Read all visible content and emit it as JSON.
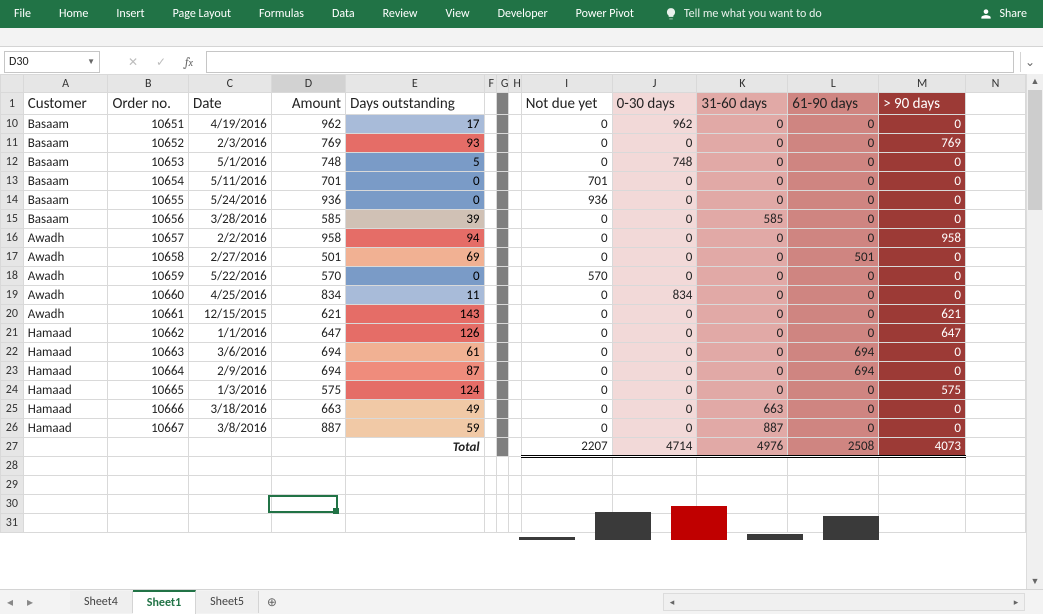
{
  "ribbon_tabs": [
    "File",
    "Home",
    "Insert",
    "Page Layout",
    "Formulas",
    "Data",
    "Review",
    "View",
    "Developer",
    "Power Pivot"
  ],
  "tell_me": "Tell me what you want to do",
  "share": "Share",
  "namebox": "D30",
  "columns": [
    "A",
    "B",
    "C",
    "D",
    "E",
    "F",
    "G",
    "H",
    "I",
    "J",
    "K",
    "L",
    "M",
    "N"
  ],
  "selected_col": "D",
  "header_row": {
    "A": "Customer",
    "B": "Order no.",
    "C": "Date",
    "D": "Amount",
    "E": "Days outstanding",
    "I": "Not due yet",
    "J": "0-30 days",
    "K": "31-60 days",
    "L": "61-90 days",
    "M": "> 90 days"
  },
  "rows": [
    {
      "r": 10,
      "A": "Basaam",
      "B": "10651",
      "C": "4/19/2016",
      "D": "962",
      "E": "17",
      "Eclass": "d1",
      "I": "0",
      "J": "962",
      "K": "0",
      "L": "0",
      "M": "0"
    },
    {
      "r": 11,
      "A": "Basaam",
      "B": "10652",
      "C": "2/3/2016",
      "D": "769",
      "E": "93",
      "Eclass": "d6",
      "I": "0",
      "J": "0",
      "K": "0",
      "L": "0",
      "M": "769"
    },
    {
      "r": 12,
      "A": "Basaam",
      "B": "10653",
      "C": "5/1/2016",
      "D": "748",
      "E": "5",
      "Eclass": "d0",
      "I": "0",
      "J": "748",
      "K": "0",
      "L": "0",
      "M": "0"
    },
    {
      "r": 13,
      "A": "Basaam",
      "B": "10654",
      "C": "5/11/2016",
      "D": "701",
      "E": "0",
      "Eclass": "d0",
      "I": "701",
      "J": "0",
      "K": "0",
      "L": "0",
      "M": "0"
    },
    {
      "r": 14,
      "A": "Basaam",
      "B": "10655",
      "C": "5/24/2016",
      "D": "936",
      "E": "0",
      "Eclass": "d0",
      "I": "936",
      "J": "0",
      "K": "0",
      "L": "0",
      "M": "0"
    },
    {
      "r": 15,
      "A": "Basaam",
      "B": "10656",
      "C": "3/28/2016",
      "D": "585",
      "E": "39",
      "Eclass": "d2",
      "I": "0",
      "J": "0",
      "K": "585",
      "L": "0",
      "M": "0"
    },
    {
      "r": 16,
      "A": "Awadh",
      "B": "10657",
      "C": "2/2/2016",
      "D": "958",
      "E": "94",
      "Eclass": "d6",
      "I": "0",
      "J": "0",
      "K": "0",
      "L": "0",
      "M": "958"
    },
    {
      "r": 17,
      "A": "Awadh",
      "B": "10658",
      "C": "2/27/2016",
      "D": "501",
      "E": "69",
      "Eclass": "d4",
      "I": "0",
      "J": "0",
      "K": "0",
      "L": "501",
      "M": "0"
    },
    {
      "r": 18,
      "A": "Awadh",
      "B": "10659",
      "C": "5/22/2016",
      "D": "570",
      "E": "0",
      "Eclass": "d0",
      "I": "570",
      "J": "0",
      "K": "0",
      "L": "0",
      "M": "0"
    },
    {
      "r": 19,
      "A": "Awadh",
      "B": "10660",
      "C": "4/25/2016",
      "D": "834",
      "E": "11",
      "Eclass": "d1",
      "I": "0",
      "J": "834",
      "K": "0",
      "L": "0",
      "M": "0"
    },
    {
      "r": 20,
      "A": "Awadh",
      "B": "10661",
      "C": "12/15/2015",
      "D": "621",
      "E": "143",
      "Eclass": "d6",
      "I": "0",
      "J": "0",
      "K": "0",
      "L": "0",
      "M": "621"
    },
    {
      "r": 21,
      "A": "Hamaad",
      "B": "10662",
      "C": "1/1/2016",
      "D": "647",
      "E": "126",
      "Eclass": "d6",
      "I": "0",
      "J": "0",
      "K": "0",
      "L": "0",
      "M": "647"
    },
    {
      "r": 22,
      "A": "Hamaad",
      "B": "10663",
      "C": "3/6/2016",
      "D": "694",
      "E": "61",
      "Eclass": "d4",
      "I": "0",
      "J": "0",
      "K": "0",
      "L": "694",
      "M": "0"
    },
    {
      "r": 23,
      "A": "Hamaad",
      "B": "10664",
      "C": "2/9/2016",
      "D": "694",
      "E": "87",
      "Eclass": "d5",
      "I": "0",
      "J": "0",
      "K": "0",
      "L": "694",
      "M": "0"
    },
    {
      "r": 24,
      "A": "Hamaad",
      "B": "10665",
      "C": "1/3/2016",
      "D": "575",
      "E": "124",
      "Eclass": "d6",
      "I": "0",
      "J": "0",
      "K": "0",
      "L": "0",
      "M": "575"
    },
    {
      "r": 25,
      "A": "Hamaad",
      "B": "10666",
      "C": "3/18/2016",
      "D": "663",
      "E": "49",
      "Eclass": "d3",
      "I": "0",
      "J": "0",
      "K": "663",
      "L": "0",
      "M": "0"
    },
    {
      "r": 26,
      "A": "Hamaad",
      "B": "10667",
      "C": "3/8/2016",
      "D": "887",
      "E": "59",
      "Eclass": "d3",
      "I": "0",
      "J": "0",
      "K": "887",
      "L": "0",
      "M": "0"
    }
  ],
  "total_label": "Total",
  "totals": {
    "I": "2207",
    "J": "4714",
    "K": "4976",
    "L": "2508",
    "M": "4073"
  },
  "sheet_tabs": [
    "Sheet4",
    "Sheet1",
    "Sheet5"
  ],
  "active_sheet": "Sheet1",
  "chart_data": {
    "type": "bar",
    "categories": [
      "Not due yet",
      "0-30 days",
      "31-60 days",
      "61-90 days",
      "> 90 days"
    ],
    "values": [
      2207,
      4714,
      4976,
      2508,
      4073
    ],
    "colors": [
      "#3a3a3a",
      "#3a3a3a",
      "#c00000",
      "#3a3a3a",
      "#3a3a3a"
    ],
    "title": "",
    "xlabel": "",
    "ylabel": "",
    "ylim": [
      0,
      5000
    ]
  }
}
